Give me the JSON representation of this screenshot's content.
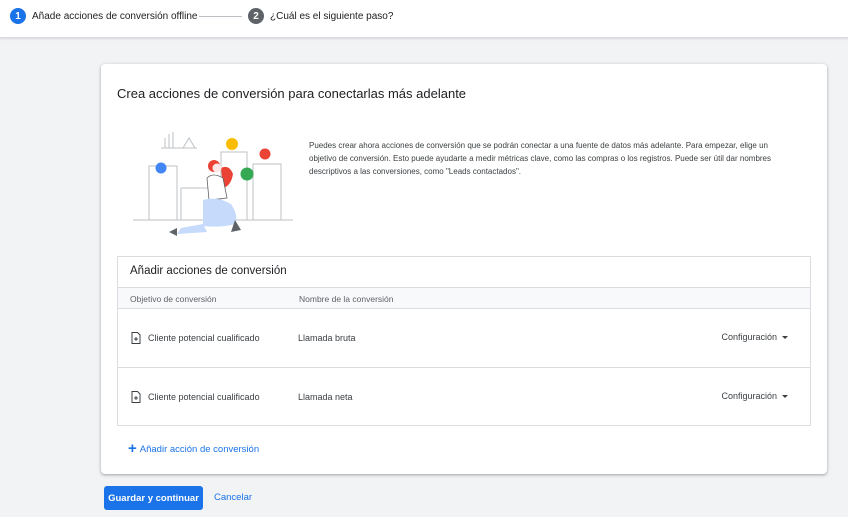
{
  "stepper": {
    "step1": {
      "number": "1",
      "label": "Añade acciones de conversión offline"
    },
    "step2": {
      "number": "2",
      "label": "¿Cuál es el siguiente paso?"
    }
  },
  "card": {
    "title": "Crea acciones de conversión para conectarlas más adelante",
    "intro": "Puedes crear ahora acciones de conversión que se podrán conectar a una fuente de datos más adelante. Para empezar, elige un objetivo de conversión. Esto puede ayudarte a medir métricas clave, como las compras o los registros. Puede ser útil dar nombres descriptivos a las conversiones, como \"Leads contactados\"."
  },
  "table": {
    "title": "Añadir acciones de conversión",
    "headers": {
      "objective": "Objetivo de conversión",
      "name": "Nombre de la conversión"
    },
    "rows": [
      {
        "objective": "Cliente potencial cualificado",
        "name": "Llamada bruta",
        "config": "Configuración"
      },
      {
        "objective": "Cliente potencial cualificado",
        "name": "Llamada neta",
        "config": "Configuración"
      }
    ]
  },
  "add_action": {
    "label": "Añadir acción de conversión",
    "icon": "plus-icon"
  },
  "actions": {
    "save": "Guardar y continuar",
    "cancel": "Cancelar"
  },
  "colors": {
    "accent": "#1a73e8",
    "step_inactive": "#5f6368"
  }
}
